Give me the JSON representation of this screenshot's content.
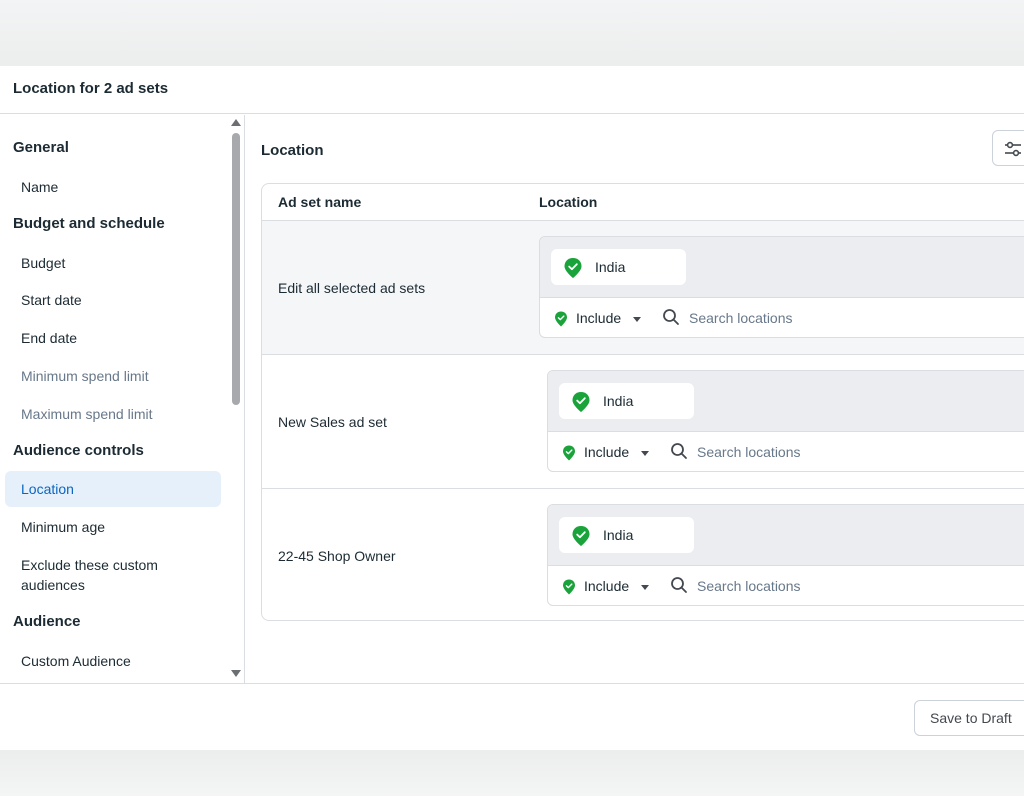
{
  "dialog": {
    "title": "Location for 2 ad sets"
  },
  "sidebar": {
    "sections": [
      {
        "label": "General",
        "items": [
          {
            "label": "Name",
            "state": "normal"
          }
        ]
      },
      {
        "label": "Budget and schedule",
        "items": [
          {
            "label": "Budget",
            "state": "normal"
          },
          {
            "label": "Start date",
            "state": "normal"
          },
          {
            "label": "End date",
            "state": "normal"
          },
          {
            "label": "Minimum spend limit",
            "state": "muted"
          },
          {
            "label": "Maximum spend limit",
            "state": "muted"
          }
        ]
      },
      {
        "label": "Audience controls",
        "items": [
          {
            "label": "Location",
            "state": "active"
          },
          {
            "label": "Minimum age",
            "state": "normal"
          },
          {
            "label": "Exclude these custom audiences",
            "state": "normal"
          }
        ]
      },
      {
        "label": "Audience",
        "items": [
          {
            "label": "Custom Audience",
            "state": "normal"
          }
        ]
      }
    ]
  },
  "main": {
    "title": "Location",
    "filter_icon": "sliders-icon",
    "table": {
      "headers": [
        "Ad set name",
        "Location"
      ],
      "rows": [
        {
          "name": "Edit all selected ad sets",
          "location_chip": "India",
          "include_label": "Include",
          "search_placeholder": "Search locations"
        },
        {
          "name": "New Sales ad set",
          "location_chip": "India",
          "include_label": "Include",
          "search_placeholder": "Search locations"
        },
        {
          "name": "22-45 Shop Owner",
          "location_chip": "India",
          "include_label": "Include",
          "search_placeholder": "Search locations"
        }
      ]
    }
  },
  "footer": {
    "save_draft_label": "Save to Draft"
  },
  "colors": {
    "accent": "#0a66c2",
    "include_green": "#1aa33a",
    "active_bg": "#e6f0fa"
  }
}
